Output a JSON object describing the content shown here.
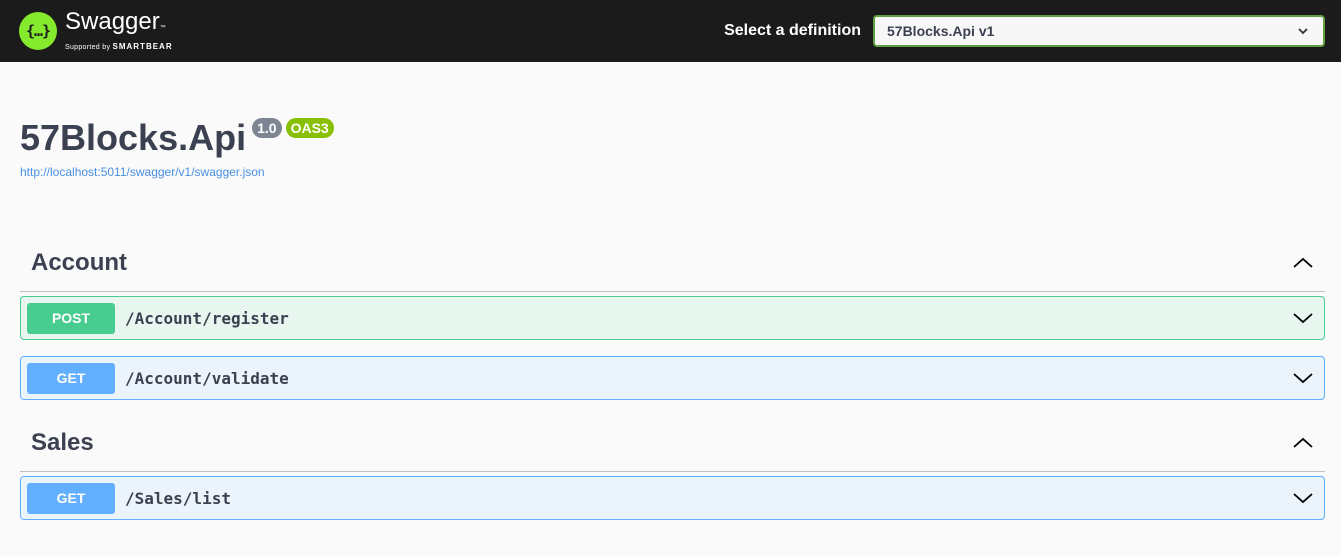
{
  "topbar": {
    "brand_name": "Swagger",
    "brand_tm": "™",
    "brand_sub_prefix": "Supported by",
    "brand_sub_company": "SMARTBEAR",
    "logo_glyph": "{…}",
    "definition_label": "Select a definition",
    "definition_selected": "57Blocks.Api v1"
  },
  "info": {
    "title": "57Blocks.Api",
    "version": "1.0",
    "oas": "OAS3",
    "url": "http://localhost:5011/swagger/v1/swagger.json"
  },
  "tags": [
    {
      "name": "Account",
      "operations": [
        {
          "method": "POST",
          "path": "/Account/register"
        },
        {
          "method": "GET",
          "path": "/Account/validate"
        }
      ]
    },
    {
      "name": "Sales",
      "operations": [
        {
          "method": "GET",
          "path": "/Sales/list"
        }
      ]
    }
  ],
  "colors": {
    "post": "#49cc90",
    "get": "#61affe",
    "brand_green": "#85ea2d",
    "oas_badge": "#89bf04"
  }
}
